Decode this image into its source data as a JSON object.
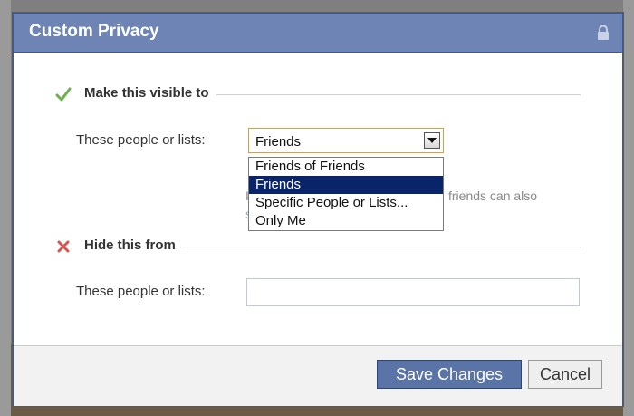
{
  "dialog": {
    "title": "Custom Privacy",
    "visible_section": {
      "heading": "Make this visible to",
      "field_label": "These people or lists:",
      "selected_value": "Friends",
      "options": [
        "Friends of Friends",
        "Friends",
        "Specific People or Lists...",
        "Only Me"
      ],
      "selected_index": 1,
      "partial_note": "friends can also"
    },
    "hide_section": {
      "heading": "Hide this from",
      "field_label": "These people or lists:",
      "input_value": ""
    },
    "buttons": {
      "save": "Save Changes",
      "cancel": "Cancel"
    }
  },
  "colors": {
    "titlebar": "#6d84b4",
    "save_button": "#5b74a8",
    "selected_option": "#0a246a"
  }
}
